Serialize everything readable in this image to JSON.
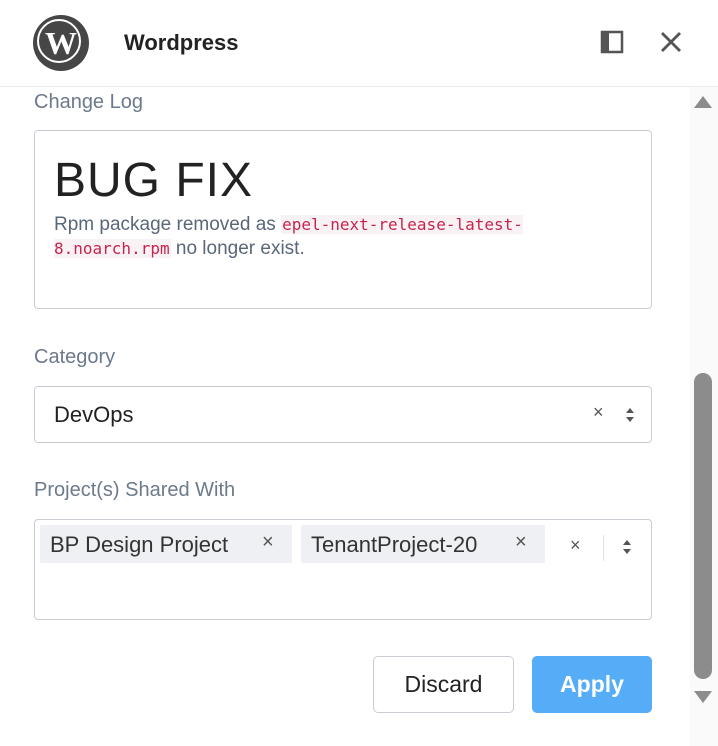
{
  "window": {
    "title": "Wordpress",
    "logo_letter": "W",
    "panel_icon": "panel-icon",
    "close_icon": "close-icon"
  },
  "changelog": {
    "label": "Change Log",
    "heading": "BUG FIX",
    "text_before": "Rpm package removed as ",
    "code": "epel-next-release-latest-8.noarch.rpm",
    "text_after": " no longer exist."
  },
  "category": {
    "label": "Category",
    "value": "DevOps",
    "clear_icon": "×"
  },
  "projects": {
    "label": "Project(s) Shared With",
    "tags": [
      {
        "label": "BP Design Project",
        "remove": "×"
      },
      {
        "label": "TenantProject-20",
        "remove": "×"
      }
    ],
    "clear_icon": "×"
  },
  "actions": {
    "discard": "Discard",
    "apply": "Apply"
  },
  "colors": {
    "accent": "#55acf7",
    "label": "#6b7a8c",
    "code": "#c7254e"
  }
}
